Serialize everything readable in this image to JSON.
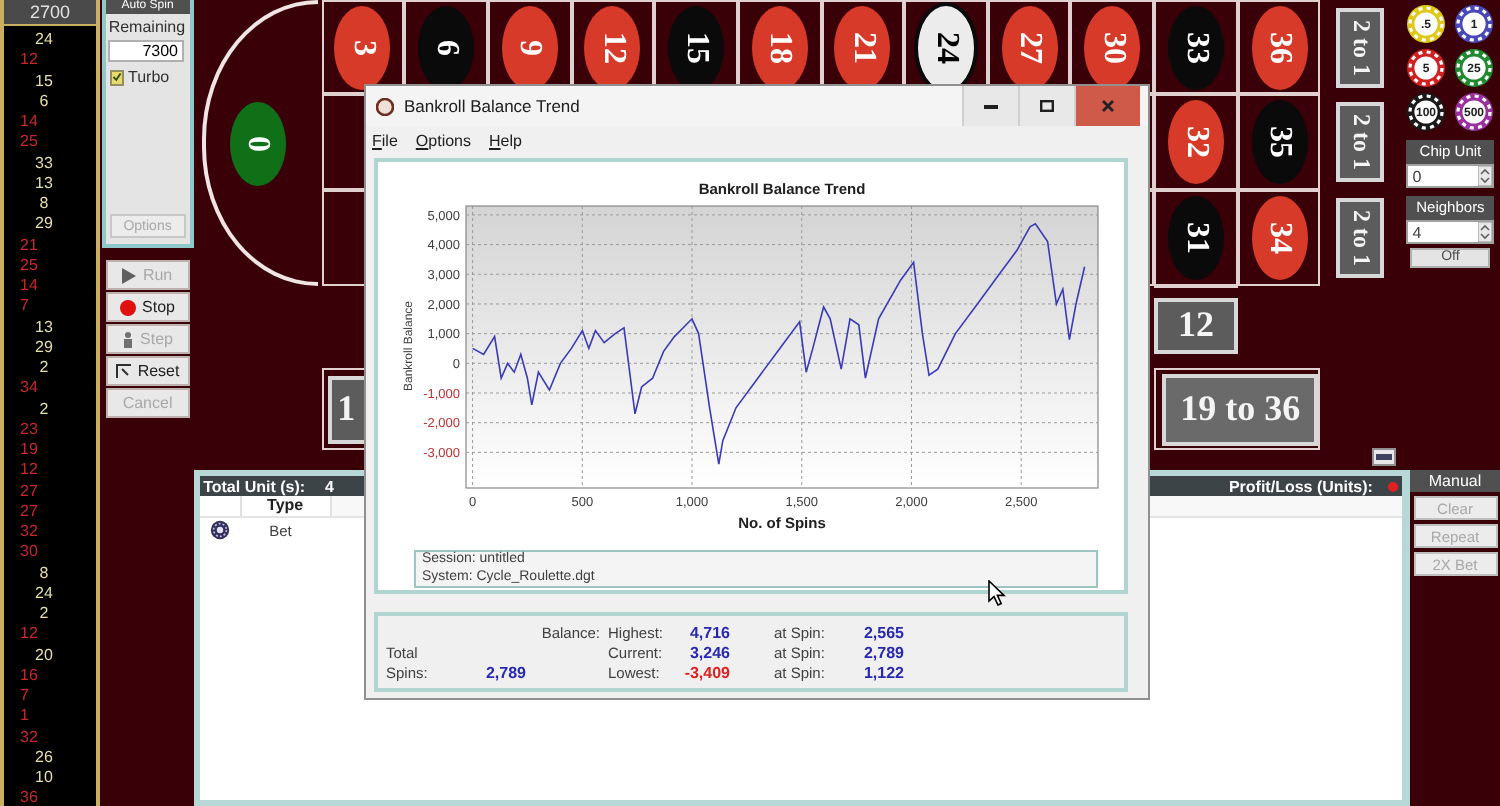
{
  "history": {
    "total": "2700",
    "spins": [
      {
        "number": "24",
        "kind": "black"
      },
      {
        "number": "12",
        "kind": "red"
      },
      {
        "number": "15",
        "kind": "black"
      },
      {
        "number": "6",
        "kind": "black"
      },
      {
        "number": "14",
        "kind": "red"
      },
      {
        "number": "25",
        "kind": "red"
      },
      {
        "number": "33",
        "kind": "black"
      },
      {
        "number": "13",
        "kind": "black"
      },
      {
        "number": "8",
        "kind": "black"
      },
      {
        "number": "29",
        "kind": "black"
      },
      {
        "number": "21",
        "kind": "red"
      },
      {
        "number": "25",
        "kind": "red"
      },
      {
        "number": "14",
        "kind": "red"
      },
      {
        "number": "7",
        "kind": "red"
      },
      {
        "number": "13",
        "kind": "black"
      },
      {
        "number": "29",
        "kind": "black"
      },
      {
        "number": "2",
        "kind": "black"
      },
      {
        "number": "34",
        "kind": "red"
      },
      {
        "number": "2",
        "kind": "black"
      },
      {
        "number": "23",
        "kind": "red"
      },
      {
        "number": "19",
        "kind": "red"
      },
      {
        "number": "12",
        "kind": "red"
      },
      {
        "number": "27",
        "kind": "red"
      },
      {
        "number": "27",
        "kind": "red"
      },
      {
        "number": "32",
        "kind": "red"
      },
      {
        "number": "30",
        "kind": "red"
      },
      {
        "number": "8",
        "kind": "black"
      },
      {
        "number": "24",
        "kind": "black"
      },
      {
        "number": "2",
        "kind": "black"
      },
      {
        "number": "12",
        "kind": "red"
      },
      {
        "number": "20",
        "kind": "black"
      },
      {
        "number": "16",
        "kind": "red"
      },
      {
        "number": "7",
        "kind": "red"
      },
      {
        "number": "1",
        "kind": "red"
      },
      {
        "number": "32",
        "kind": "red"
      },
      {
        "number": "26",
        "kind": "black"
      },
      {
        "number": "10",
        "kind": "black"
      },
      {
        "number": "36",
        "kind": "red"
      }
    ]
  },
  "auto_spin": {
    "title": "Auto Spin",
    "remaining_label": "Remaining",
    "remaining_value": "7300",
    "turbo": {
      "label": "Turbo",
      "checked": true
    },
    "options_button": {
      "label": "Options",
      "disabled": true
    }
  },
  "spin_buttons": [
    {
      "label": "Run",
      "kind": "play",
      "disabled": true
    },
    {
      "label": "Stop",
      "kind": "stop",
      "disabled": false
    },
    {
      "label": "Step",
      "kind": "step",
      "disabled": true
    },
    {
      "label": "Reset",
      "kind": "reset",
      "disabled": false
    },
    {
      "label": "Cancel",
      "kind": "plain",
      "disabled": true
    }
  ],
  "board": {
    "zero": "0",
    "rows": [
      [
        {
          "number": "3",
          "color": "#d83a2a",
          "highlighted": false
        },
        {
          "number": "6",
          "color": "#0a0a0a",
          "highlighted": false
        },
        {
          "number": "9",
          "color": "#d83a2a",
          "highlighted": false
        },
        {
          "number": "12",
          "color": "#d83a2a",
          "highlighted": false
        },
        {
          "number": "15",
          "color": "#0a0a0a",
          "highlighted": false
        },
        {
          "number": "18",
          "color": "#d83a2a",
          "highlighted": false
        },
        {
          "number": "21",
          "color": "#d83a2a",
          "highlighted": false
        },
        {
          "number": "24",
          "color": "#0a0a0a",
          "highlighted": true
        },
        {
          "number": "27",
          "color": "#d83a2a",
          "highlighted": false
        },
        {
          "number": "30",
          "color": "#d83a2a",
          "highlighted": false
        },
        {
          "number": "33",
          "color": "#0a0a0a",
          "highlighted": false
        },
        {
          "number": "36",
          "color": "#d83a2a",
          "highlighted": false
        }
      ],
      [
        {
          "number": "32",
          "color": "#d83a2a",
          "highlighted": false
        },
        {
          "number": "35",
          "color": "#0a0a0a",
          "highlighted": false
        }
      ],
      [
        {
          "number": "31",
          "color": "#0a0a0a",
          "highlighted": false
        },
        {
          "number": "34",
          "color": "#d83a2a",
          "highlighted": false
        }
      ]
    ],
    "column_bets": [
      "2 to 1",
      "2 to 1",
      "2 to 1"
    ],
    "dozen_bets": [
      "12"
    ],
    "outside_bets": [
      "1",
      "19 to 36"
    ]
  },
  "chips": [
    {
      "label": ".5",
      "color": "#e0c818"
    },
    {
      "label": "1",
      "color": "#4848b8"
    },
    {
      "label": "5",
      "color": "#d02020"
    },
    {
      "label": "25",
      "color": "#208a30"
    },
    {
      "label": "100",
      "color": "#1a1a1a"
    },
    {
      "label": "500",
      "color": "#9a30a0"
    }
  ],
  "chip_unit": {
    "label": "Chip Unit",
    "value": "0"
  },
  "neighbors": {
    "label": "Neighbors",
    "value": "4"
  },
  "off_button": "Off",
  "bets_panel": {
    "total_label": "Total Unit (s):",
    "total_value": "4",
    "profit_label": "Profit/Loss (Units):",
    "columns": [
      "Type"
    ],
    "rows": [
      {
        "type": "Bet"
      }
    ]
  },
  "manual": {
    "title": "Manual",
    "buttons": [
      {
        "label": "Clear",
        "disabled": true
      },
      {
        "label": "Repeat",
        "disabled": true
      },
      {
        "label": "2X Bet",
        "disabled": true
      }
    ]
  },
  "dialog": {
    "title": "Bankroll Balance Trend",
    "menu": [
      "File",
      "Options",
      "Help"
    ],
    "chart_data": {
      "type": "line",
      "title": "Bankroll Balance Trend",
      "xlabel": "No. of Spins",
      "ylabel": "Bankroll Balance",
      "x": [
        0,
        50,
        100,
        130,
        160,
        190,
        220,
        250,
        270,
        300,
        350,
        400,
        450,
        500,
        530,
        560,
        600,
        650,
        690,
        740,
        770,
        820,
        870,
        920,
        960,
        1000,
        1030,
        1080,
        1122,
        1140,
        1200,
        1300,
        1400,
        1490,
        1520,
        1550,
        1600,
        1630,
        1680,
        1720,
        1760,
        1790,
        1850,
        1950,
        2010,
        2050,
        2080,
        2120,
        2200,
        2300,
        2400,
        2480,
        2540,
        2565,
        2620,
        2660,
        2690,
        2720,
        2750,
        2789
      ],
      "series": [
        {
          "color": "#3a3ab8",
          "values": [
            500,
            300,
            900,
            -500,
            0,
            -300,
            300,
            -500,
            -1400,
            -300,
            -900,
            0,
            500,
            1100,
            500,
            1100,
            700,
            1000,
            1200,
            -1700,
            -800,
            -500,
            400,
            900,
            1200,
            1500,
            1000,
            -1500,
            -3400,
            -2600,
            -1500,
            -500,
            500,
            1400,
            -300,
            500,
            1900,
            1500,
            -200,
            1500,
            1300,
            -500,
            1500,
            2800,
            3400,
            1000,
            -400,
            -200,
            1000,
            2000,
            3000,
            3800,
            4600,
            4700,
            4100,
            2000,
            2500,
            800,
            2000,
            3250
          ]
        }
      ],
      "grid": true,
      "xlim": [
        -30,
        2850
      ],
      "ylim": [
        -4200,
        5300
      ],
      "xticks": [
        {
          "value": 0,
          "label": "0"
        },
        {
          "value": 500,
          "label": "500"
        },
        {
          "value": 1000,
          "label": "1,000"
        },
        {
          "value": 1500,
          "label": "1,500"
        },
        {
          "value": 2000,
          "label": "2,000"
        },
        {
          "value": 2500,
          "label": "2,500"
        }
      ],
      "yticks": [
        {
          "value": 5000,
          "label": "5,000"
        },
        {
          "value": 4000,
          "label": "4,000"
        },
        {
          "value": 3000,
          "label": "3,000"
        },
        {
          "value": 2000,
          "label": "2,000"
        },
        {
          "value": 1000,
          "label": "1,000"
        },
        {
          "value": 0,
          "label": "0"
        },
        {
          "value": -1000,
          "label": "-1,000"
        },
        {
          "value": -2000,
          "label": "-2,000"
        },
        {
          "value": -3000,
          "label": "-3,000"
        }
      ]
    },
    "session": "Session: untitled",
    "system": "System: Cycle_Roulette.dgt",
    "summary": {
      "total_label": "Total",
      "spins_label": "Spins:",
      "spins_value": "2,789",
      "balance_label": "Balance:",
      "rows": [
        {
          "label": "Highest:",
          "value": "4,716",
          "negative": false,
          "at_label": "at Spin:",
          "at_value": "2,565"
        },
        {
          "label": "Current:",
          "value": "3,246",
          "negative": false,
          "at_label": "at Spin:",
          "at_value": "2,789"
        },
        {
          "label": "Lowest:",
          "value": "-3,409",
          "negative": true,
          "at_label": "at Spin:",
          "at_value": "1,122"
        }
      ]
    }
  }
}
